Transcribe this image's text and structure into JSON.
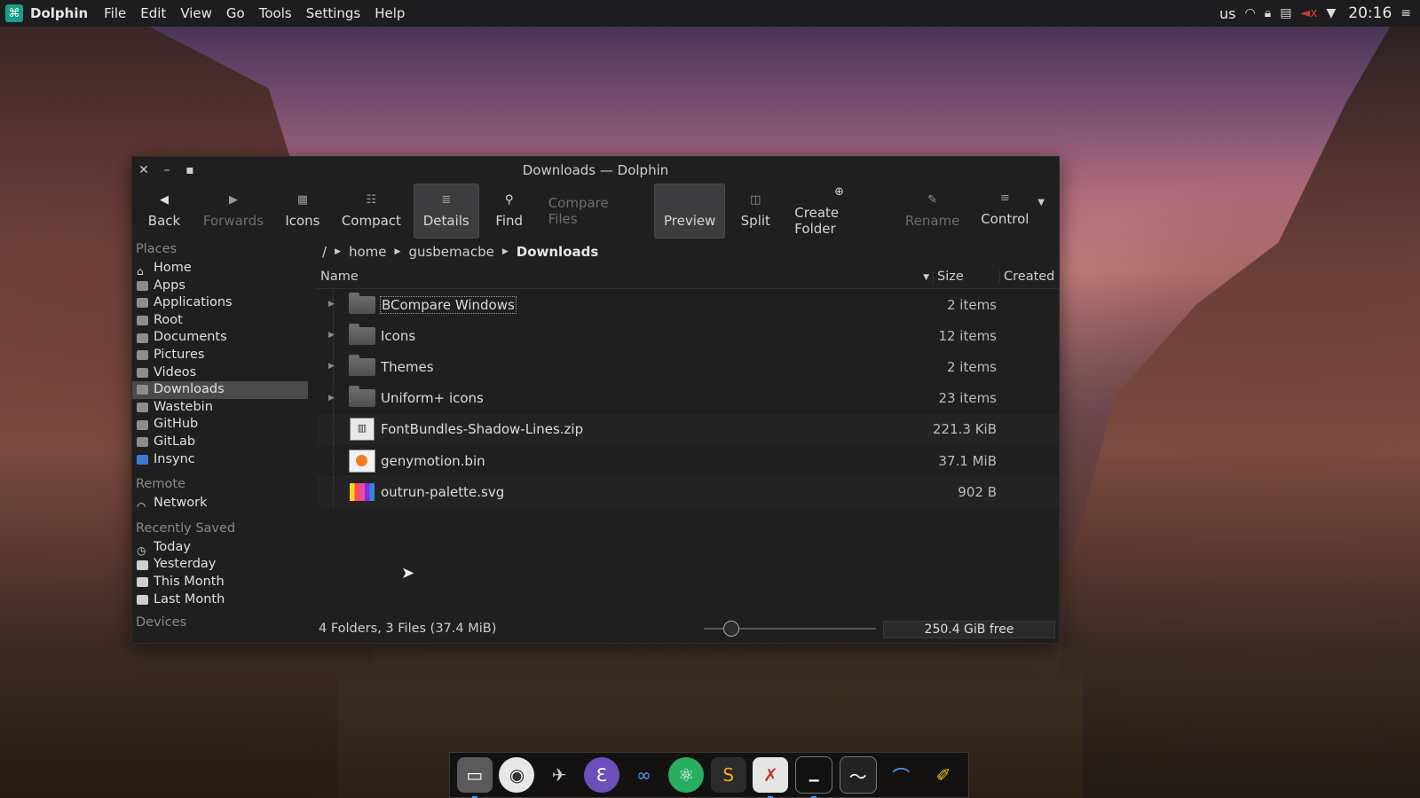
{
  "topbar": {
    "app_name": "Dolphin",
    "menus": [
      "File",
      "Edit",
      "View",
      "Go",
      "Tools",
      "Settings",
      "Help"
    ],
    "keyboard_layout": "us",
    "clock": "20:16"
  },
  "window": {
    "title": "Downloads — Dolphin",
    "toolbar": {
      "back": "Back",
      "forwards": "Forwards",
      "icons": "Icons",
      "compact": "Compact",
      "details": "Details",
      "find": "Find",
      "compare_files": "Compare Files",
      "preview": "Preview",
      "split": "Split",
      "create_folder": "Create Folder",
      "rename": "Rename",
      "control": "Control"
    }
  },
  "sidebar": {
    "places_title": "Places",
    "places": [
      "Home",
      "Apps",
      "Applications",
      "Root",
      "Documents",
      "Pictures",
      "Videos",
      "Downloads",
      "Wastebin",
      "GitHub",
      "GitLab",
      "Insync"
    ],
    "selected_place": "Downloads",
    "remote_title": "Remote",
    "remote": [
      "Network"
    ],
    "recent_title": "Recently Saved",
    "recent": [
      "Today",
      "Yesterday",
      "This Month",
      "Last Month"
    ],
    "devices_title": "Devices"
  },
  "breadcrumb": {
    "root": "/",
    "parts": [
      "home",
      "gusbemacbe",
      "Downloads"
    ]
  },
  "columns": {
    "name": "Name",
    "size": "Size",
    "created": "Created"
  },
  "files": [
    {
      "name": "BCompare Windows",
      "size": "2 items",
      "type": "folder"
    },
    {
      "name": "Icons",
      "size": "12 items",
      "type": "folder"
    },
    {
      "name": "Themes",
      "size": "2 items",
      "type": "folder"
    },
    {
      "name": "Uniform+ icons",
      "size": "23 items",
      "type": "folder"
    },
    {
      "name": "FontBundles-Shadow-Lines.zip",
      "size": "221.3 KiB",
      "type": "zip"
    },
    {
      "name": "genymotion.bin",
      "size": "37.1 MiB",
      "type": "bin"
    },
    {
      "name": "outrun-palette.svg",
      "size": "902 B",
      "type": "svg"
    }
  ],
  "status": {
    "summary": "4 Folders, 3 Files (37.4 MiB)",
    "free_space": "250.4 GiB free"
  }
}
